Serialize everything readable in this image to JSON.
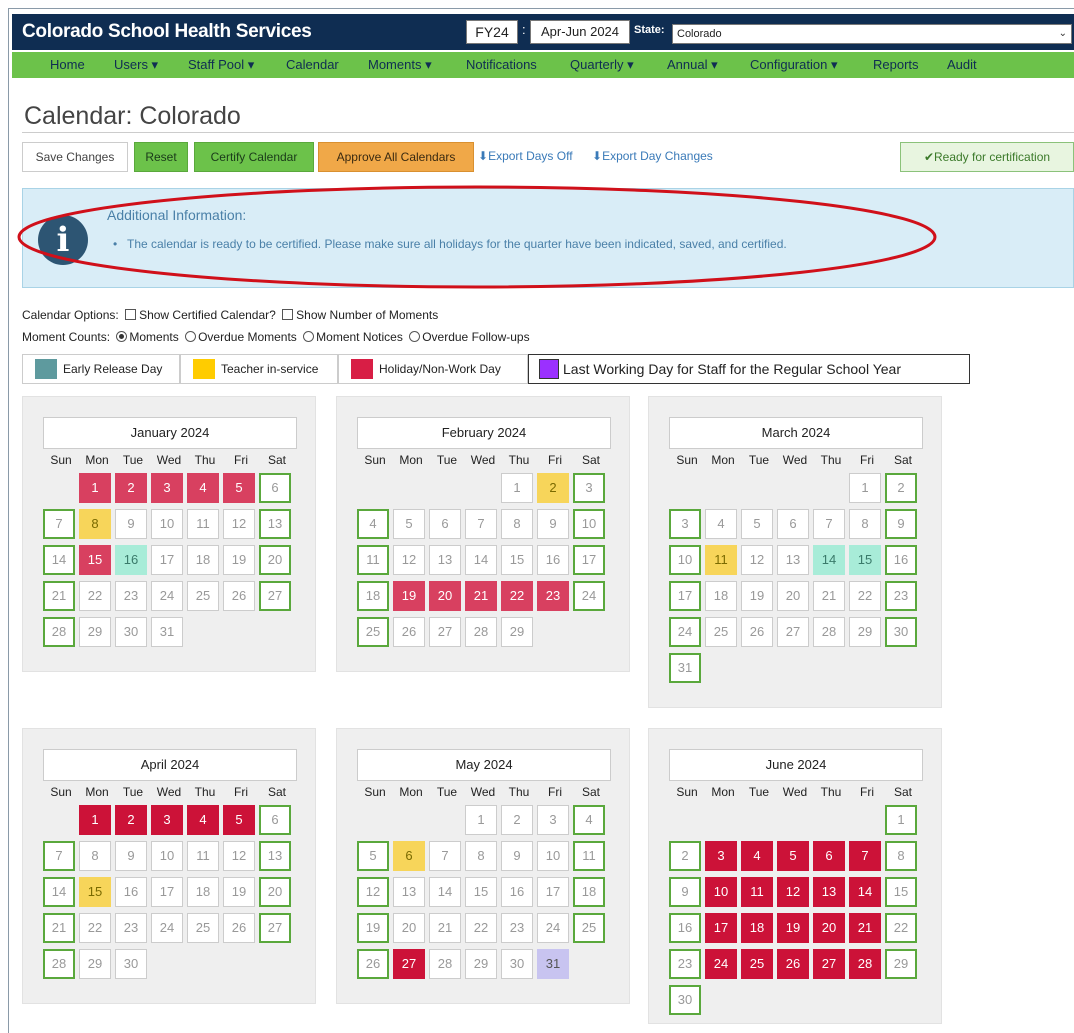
{
  "app": {
    "title": "Colorado School Health Services",
    "fiscal_year": "FY24",
    "separator": ":",
    "quarter": "Apr-Jun 2024",
    "state_label": "State:",
    "state_value": "Colorado"
  },
  "nav": [
    "Home",
    "Users ▾",
    "Staff Pool ▾",
    "Calendar",
    "Moments ▾",
    "Notifications",
    "Quarterly ▾",
    "Annual ▾",
    "Configuration ▾",
    "Reports",
    "Audit"
  ],
  "page": {
    "title": "Calendar: Colorado"
  },
  "toolbar": {
    "save_label": "Save Changes",
    "reset_label": "Reset",
    "certify_label": "Certify Calendar",
    "approve_label": "Approve All Calendars",
    "export_off_label": "Export Days Off",
    "export_changes_label": "Export Day Changes",
    "ready_label": "✔Ready for certification"
  },
  "info": {
    "icon": "info-icon",
    "glyph": "i",
    "heading": "Additional Information:",
    "message": "The calendar is ready to be certified. Please make sure all holidays for the quarter have been indicated, saved, and certified."
  },
  "options": {
    "calendar_options_label": "Calendar Options:",
    "show_certified": "Show Certified Calendar?",
    "show_moments": "Show Number of Moments",
    "moment_counts_label": "Moment Counts:",
    "radio_moments": "Moments",
    "radio_overdue_moments": "Overdue Moments",
    "radio_notices": "Moment Notices",
    "radio_followups": "Overdue Follow-ups"
  },
  "legend": {
    "early": "Early Release Day",
    "teacher": "Teacher in-service",
    "holiday": "Holiday/Non-Work Day",
    "last": "Last Working Day for Staff for the Regular School Year"
  },
  "colors": {
    "early": "#5e9a9e",
    "teacher": "#ffcc00",
    "holiday": "#d81e45",
    "last": "#9b30ff",
    "nav_green": "#6cc24a",
    "top_navy": "#0f2d52"
  },
  "weekdays": [
    "Sun",
    "Mon",
    "Tue",
    "Wed",
    "Thu",
    "Fri",
    "Sat"
  ],
  "months": [
    {
      "name": "January 2024",
      "start": 1,
      "days": 31,
      "marks": {
        "1": "hol",
        "2": "hol",
        "3": "hol",
        "4": "hol",
        "5": "hol",
        "8": "teach",
        "15": "hol",
        "16": "early"
      }
    },
    {
      "name": "February 2024",
      "start": 4,
      "days": 29,
      "marks": {
        "2": "teach",
        "19": "hol",
        "20": "hol",
        "21": "hol",
        "22": "hol",
        "23": "hol"
      }
    },
    {
      "name": "March 2024",
      "start": 5,
      "days": 31,
      "marks": {
        "11": "teach",
        "14": "early",
        "15": "early"
      }
    },
    {
      "name": "April 2024",
      "start": 1,
      "days": 30,
      "marks": {
        "1": "hol2",
        "2": "hol2",
        "3": "hol2",
        "4": "hol2",
        "5": "hol2",
        "15": "teach"
      }
    },
    {
      "name": "May 2024",
      "start": 3,
      "days": 31,
      "marks": {
        "6": "teach",
        "27": "hol2",
        "31": "last"
      }
    },
    {
      "name": "June 2024",
      "start": 6,
      "days": 30,
      "marks": {
        "3": "hol2",
        "4": "hol2",
        "5": "hol2",
        "6": "hol2",
        "7": "hol2",
        "10": "hol2",
        "11": "hol2",
        "12": "hol2",
        "13": "hol2",
        "14": "hol2",
        "17": "hol2",
        "18": "hol2",
        "19": "hol2",
        "20": "hol2",
        "21": "hol2",
        "24": "hol2",
        "25": "hol2",
        "26": "hol2",
        "27": "hol2",
        "28": "hol2"
      }
    }
  ]
}
